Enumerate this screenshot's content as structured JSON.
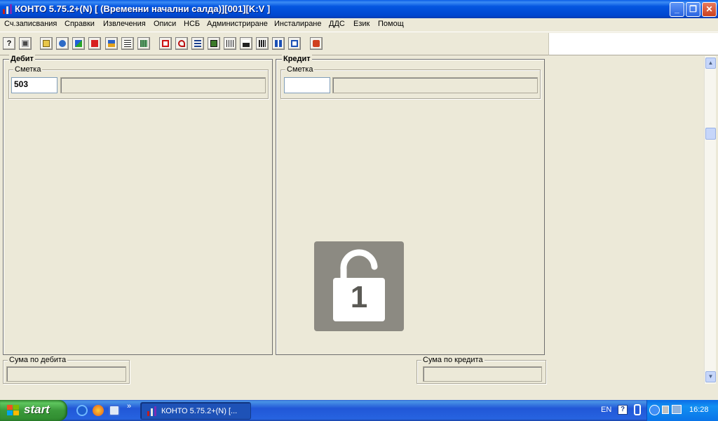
{
  "window": {
    "title": "КОНТО 5.75.2+(N) [ (Временни начални салда)][001][K:V ]",
    "minimize_glyph": "_",
    "maximize_glyph": "❐",
    "close_glyph": "✕"
  },
  "menu": {
    "items": [
      "Сч.записвания",
      "Справки",
      "Извлечения",
      "Описи",
      "НСБ",
      "Администриране",
      "Инсталиране",
      "ДДС",
      "Език",
      "Помощ"
    ]
  },
  "toolbar": {
    "help_glyph": "?",
    "icons": [
      "help-icon",
      "save-icon",
      "copy-icon",
      "gear-icon",
      "chart-icon",
      "sum-icon",
      "tree-icon",
      "document-icon",
      "calculator-icon",
      "report-icon",
      "undo-icon",
      "list-icon",
      "book-icon",
      "table-icon",
      "balance-icon",
      "bar-chart-icon",
      "column-chart-icon",
      "edit-icon",
      "print-icon"
    ]
  },
  "debit": {
    "title": "Дебит",
    "account_label": "Сметка",
    "account_value": "503",
    "account_name": ""
  },
  "credit": {
    "title": "Кредит",
    "account_label": "Сметка",
    "account_value": "",
    "account_name": ""
  },
  "totals": {
    "debit_label": "Сума по дебита",
    "credit_label": "Сума по кредита",
    "debit_value": "",
    "credit_value": ""
  },
  "overlay": {
    "lock_number": "1"
  },
  "taskbar": {
    "start_label": "start",
    "task_label": "КОНТО 5.75.2+(N) [...",
    "language": "EN",
    "clock": "16:28",
    "chevron": "»"
  },
  "colors": {
    "title_bar": "#0a4fdc",
    "window_bg": "#ece9d8",
    "taskbar": "#2459d6",
    "start_green": "#3a9a3a",
    "lock_bg": "#8c8a82"
  }
}
